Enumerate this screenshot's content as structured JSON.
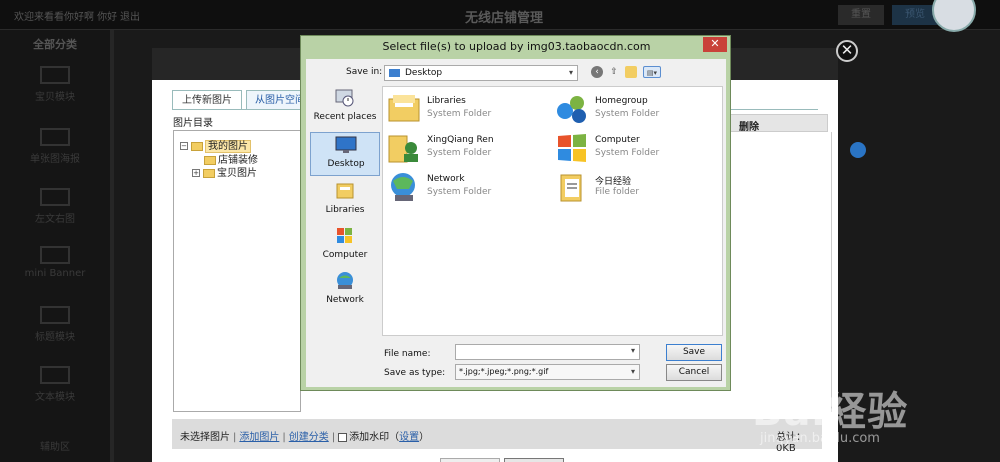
{
  "topbar": {
    "greeting": "欢迎来看看你好啊 你好",
    "logout": "退出",
    "page_title": "无线店铺管理",
    "btn_release": "重置",
    "btn_preview": "预览"
  },
  "leftnav": {
    "header": "全部分类",
    "items": [
      "宝贝模块",
      "单张图海报",
      "左文右图",
      "mini Banner",
      "标题模块",
      "文本模块",
      "辅助区"
    ]
  },
  "upload": {
    "close_glyph": "✕",
    "tab_upload": "上传新图片",
    "tab_space": "从图片空间",
    "dir_label": "图片目录",
    "tree": {
      "root": "我的图片",
      "child1": "店铺装修",
      "child2": "宝贝图片"
    },
    "col_delete": "删除",
    "footer": {
      "none_selected": "未选择图片",
      "add_image": "添加图片",
      "create_category": "创建分类",
      "add_watermark": "添加水印",
      "settings": "设置",
      "total": "总计：0KB"
    }
  },
  "file_dialog": {
    "title": "Select file(s) to upload by img03.taobaocdn.com",
    "close_glyph": "✕",
    "save_in_label": "Save in:",
    "save_in_value": "Desktop",
    "places": [
      "Recent places",
      "Desktop",
      "Libraries",
      "Computer",
      "Network"
    ],
    "items": [
      {
        "name": "Libraries",
        "type": "System Folder"
      },
      {
        "name": "Homegroup",
        "type": "System Folder"
      },
      {
        "name": "XingQiang Ren",
        "type": "System Folder"
      },
      {
        "name": "Computer",
        "type": "System Folder"
      },
      {
        "name": "Network",
        "type": "System Folder"
      },
      {
        "name": "今日经验",
        "type": "File folder"
      }
    ],
    "file_name_label": "File name:",
    "file_name_value": "",
    "save_as_type_label": "Save as type:",
    "save_as_type_value": "*.jpg;*.jpeg;*.png;*.gif",
    "btn_save": "Save",
    "btn_cancel": "Cancel"
  },
  "watermark": {
    "brand": "Bai経验",
    "url": "jingyan.baidu.com"
  }
}
